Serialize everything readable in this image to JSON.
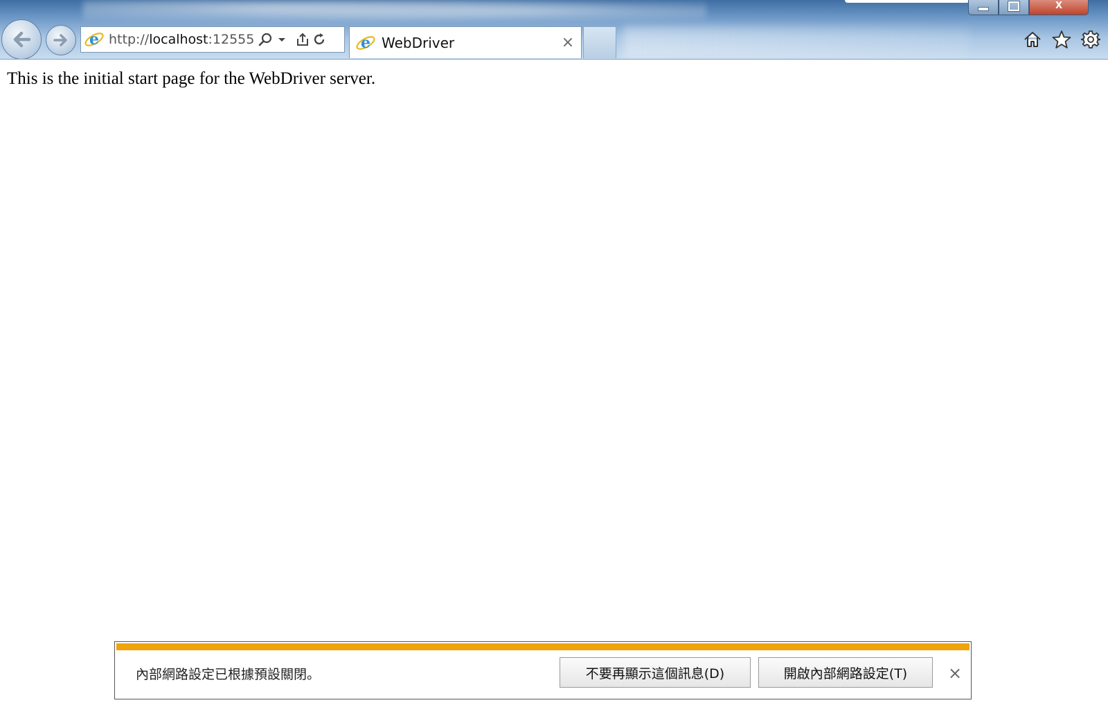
{
  "browser": {
    "address_url_prefix": "http://",
    "address_url_host": "localhost",
    "address_url_port": ":12555",
    "tab_title": "WebDriver",
    "tab_close_glyph": "×",
    "icons": {
      "back": "back-arrow-icon",
      "forward": "forward-arrow-icon",
      "site": "internet-explorer-icon",
      "search": "search-icon",
      "dropdown": "chevron-down-icon",
      "compat": "compatibility-view-icon",
      "refresh": "refresh-icon",
      "home": "home-icon",
      "favorites": "star-icon",
      "tools": "gear-icon"
    },
    "window_close_glyph": "X"
  },
  "page": {
    "text": "This is the initial start page for the WebDriver server."
  },
  "notification": {
    "message": "內部網路設定已根據預設關閉。",
    "dont_show_label": "不要再顯示這個訊息(D)",
    "enable_label": "開啟內部網路設定(T)",
    "close_glyph": "×",
    "accent_color": "#f0a30a"
  }
}
